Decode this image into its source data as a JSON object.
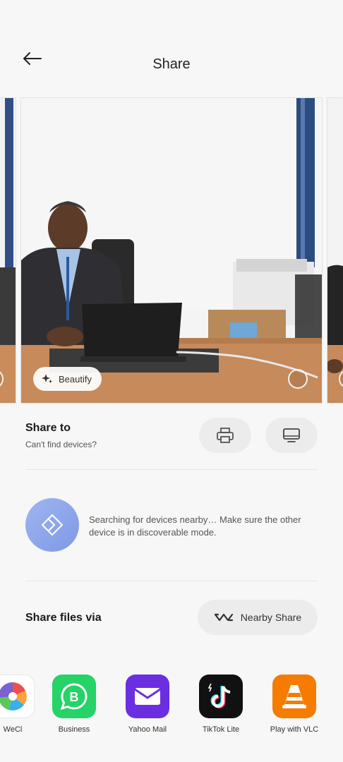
{
  "header": {
    "title": "Share"
  },
  "preview": {
    "beautify_label": "Beautify"
  },
  "share_to": {
    "title": "Share to",
    "subtitle": "Can't find devices?"
  },
  "searching": {
    "message": "Searching for devices nearby… Make sure the other device is in discoverable mode."
  },
  "share_via": {
    "title": "Share files via",
    "nearby_label": "Nearby Share"
  },
  "apps": [
    {
      "label": "WeCl",
      "icon": "wechat-icon"
    },
    {
      "label": "Business",
      "icon": "whatsapp-business-icon"
    },
    {
      "label": "Yahoo Mail",
      "icon": "yahoo-mail-icon"
    },
    {
      "label": "TikTok Lite",
      "icon": "tiktok-lite-icon"
    },
    {
      "label": "Play with VLC",
      "icon": "vlc-icon"
    }
  ],
  "colors": {
    "background": "#f7f7f7",
    "whatsapp": "#25d366",
    "yahoo": "#6b2ee0",
    "tiktok": "#111111",
    "vlc": "#f57c00",
    "search_orb": "#8ea7ec"
  }
}
